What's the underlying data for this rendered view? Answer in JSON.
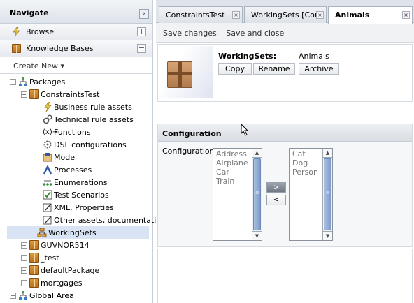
{
  "navigate": {
    "title": "Navigate",
    "collapse": "«"
  },
  "browse": {
    "label": "Browse",
    "btn": "+"
  },
  "kb": {
    "label": "Knowledge Bases",
    "btn": "−"
  },
  "create_new": "Create New ▾",
  "tree": {
    "packages": "Packages",
    "constraints_test": "ConstraintsTest",
    "children": [
      "Business rule assets",
      "Technical rule assets",
      "Functions",
      "DSL configurations",
      "Model",
      "Processes",
      "Enumerations",
      "Test Scenarios",
      "XML, Properties",
      "Other assets, documentation",
      "WorkingSets"
    ],
    "guvnor": "GUVNOR514",
    "test": "_test",
    "default_package": "defaultPackage",
    "mortgages": "mortgages",
    "global_area": "Global Area",
    "func_prefix": "(x)="
  },
  "tabs": [
    {
      "label": "ConstraintsTest",
      "close": "×"
    },
    {
      "label": "WorkingSets [Cons",
      "close": "×"
    },
    {
      "label": "Animals",
      "close": "×"
    }
  ],
  "toolbar": {
    "save_changes": "Save changes",
    "save_close": "Save and close"
  },
  "asset": {
    "type_label": "WorkingSets:",
    "name": "Animals",
    "copy": "Copy",
    "rename": "Rename",
    "archive": "Archive"
  },
  "config": {
    "header": "Configuration",
    "label": "Configuration:",
    "available": [
      "Address",
      "Airplane",
      "Car",
      "Train"
    ],
    "selected": [
      "Cat",
      "Dog",
      "Person"
    ],
    "add": ">",
    "remove": "<",
    "scroll_up": "▲",
    "scroll_down": "▼",
    "thumb_grip": "≡"
  }
}
